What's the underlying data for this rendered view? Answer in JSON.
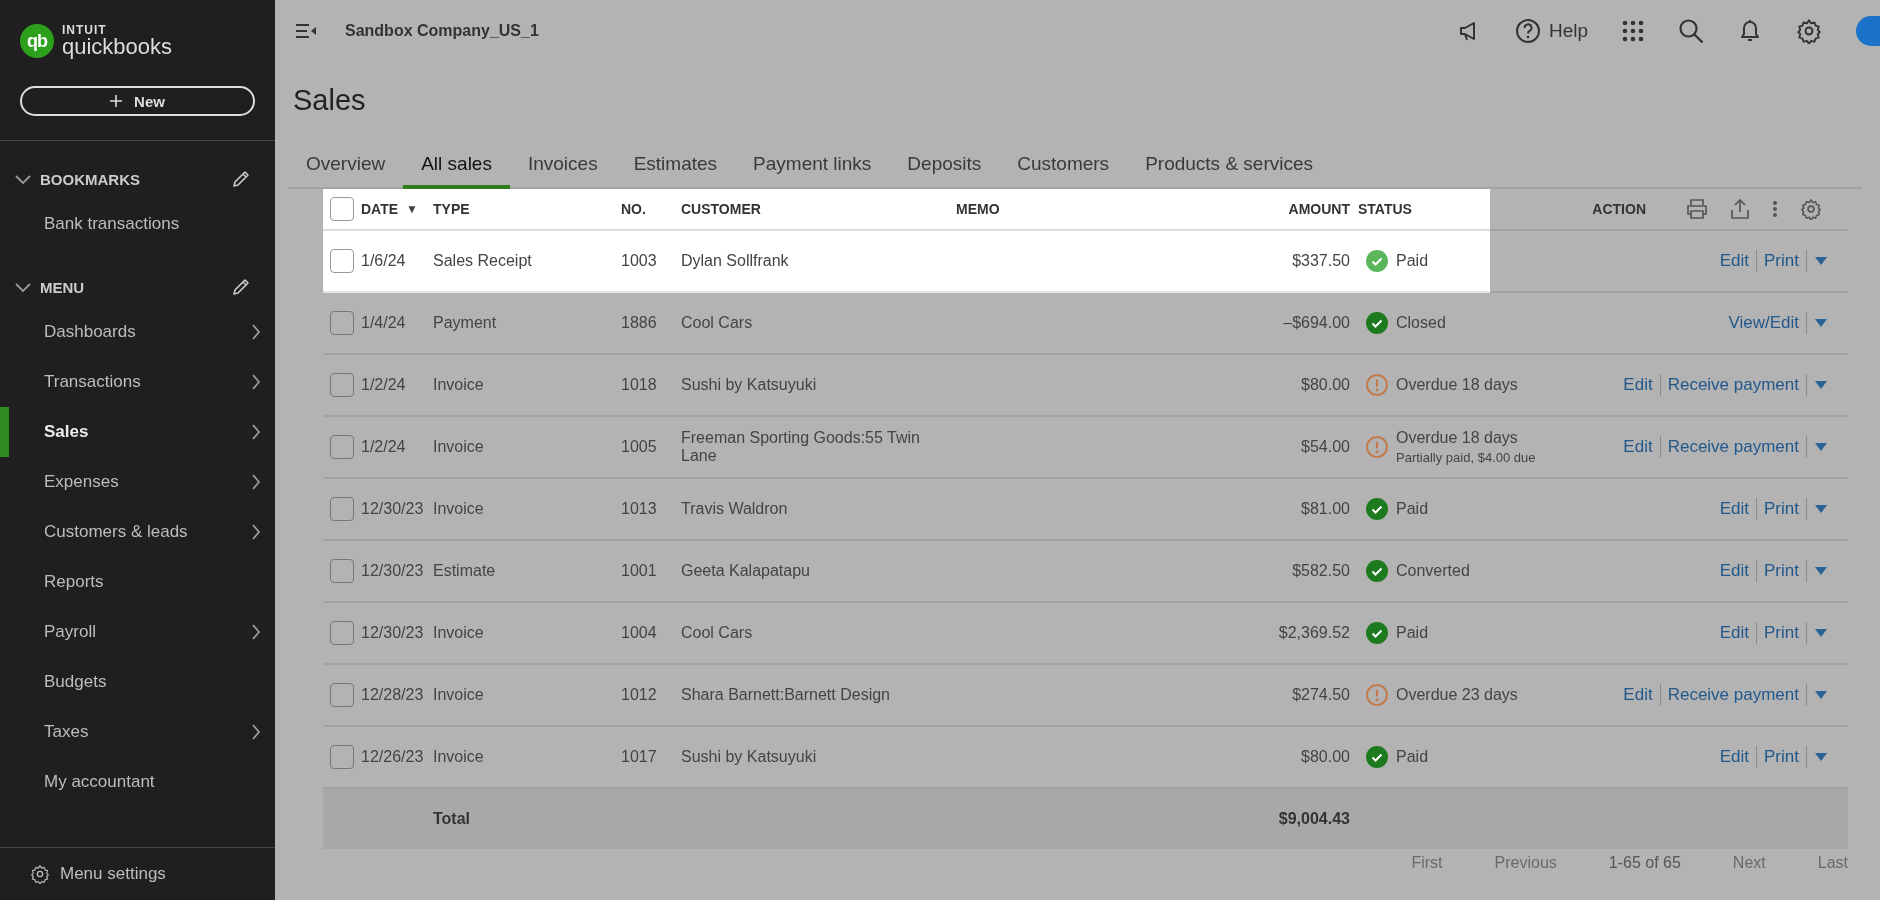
{
  "sidebar": {
    "logo": {
      "mark": "qb",
      "brand": "INTUIT",
      "product": "quickbooks"
    },
    "new_button": {
      "label": "New"
    },
    "sections": [
      {
        "title": "BOOKMARKS",
        "expanded": true,
        "items": [
          {
            "label": "Bank transactions",
            "selected": false,
            "has_children": false
          }
        ]
      },
      {
        "title": "MENU",
        "expanded": true,
        "items": [
          {
            "label": "Dashboards",
            "selected": false,
            "has_children": true
          },
          {
            "label": "Transactions",
            "selected": false,
            "has_children": true
          },
          {
            "label": "Sales",
            "selected": true,
            "has_children": true
          },
          {
            "label": "Expenses",
            "selected": false,
            "has_children": true
          },
          {
            "label": "Customers & leads",
            "selected": false,
            "has_children": true
          },
          {
            "label": "Reports",
            "selected": false,
            "has_children": false
          },
          {
            "label": "Payroll",
            "selected": false,
            "has_children": true
          },
          {
            "label": "Budgets",
            "selected": false,
            "has_children": false
          },
          {
            "label": "Taxes",
            "selected": false,
            "has_children": true
          },
          {
            "label": "My accountant",
            "selected": false,
            "has_children": false
          }
        ]
      }
    ],
    "footer": {
      "label": "Menu settings"
    }
  },
  "top_bar": {
    "company": "Sandbox Company_US_1",
    "help": "Help"
  },
  "page": {
    "title": "Sales"
  },
  "tabs": [
    {
      "label": "Overview",
      "selected": false
    },
    {
      "label": "All sales",
      "selected": true
    },
    {
      "label": "Invoices",
      "selected": false
    },
    {
      "label": "Estimates",
      "selected": false
    },
    {
      "label": "Payment links",
      "selected": false
    },
    {
      "label": "Deposits",
      "selected": false
    },
    {
      "label": "Customers",
      "selected": false
    },
    {
      "label": "Products & services",
      "selected": false
    }
  ],
  "table": {
    "header_highlighted": true,
    "select_all_checked": false,
    "columns": [
      {
        "label": "DATE",
        "sort": "▼"
      },
      {
        "label": "TYPE"
      },
      {
        "label": "NO."
      },
      {
        "label": "CUSTOMER"
      },
      {
        "label": "MEMO"
      },
      {
        "label": "AMOUNT"
      },
      {
        "label": "STATUS"
      },
      {
        "label": "ACTION"
      }
    ],
    "rows": [
      {
        "highlighted": true,
        "checked": false,
        "date": "1/6/24",
        "type": "Sales Receipt",
        "no": "1003",
        "customer": "Dylan Sollfrank",
        "amount": "$337.50",
        "status": {
          "kind": "check",
          "label": "Paid"
        },
        "actions": [
          "Edit",
          "Print"
        ]
      },
      {
        "highlighted": false,
        "checked": false,
        "date": "1/4/24",
        "type": "Payment",
        "no": "1886",
        "customer": "Cool Cars",
        "amount": "–$694.00",
        "status": {
          "kind": "check",
          "label": "Closed"
        },
        "actions": [
          "View/Edit"
        ]
      },
      {
        "highlighted": false,
        "checked": false,
        "date": "1/2/24",
        "type": "Invoice",
        "no": "1018",
        "customer": "Sushi by Katsuyuki",
        "amount": "$80.00",
        "status": {
          "kind": "warning",
          "label": "Overdue 18 days"
        },
        "actions": [
          "Edit",
          "Receive payment"
        ]
      },
      {
        "highlighted": false,
        "checked": false,
        "date": "1/2/24",
        "type": "Invoice",
        "no": "1005",
        "customer": "Freeman Sporting Goods:55 Twin Lane",
        "amount": "$54.00",
        "status": {
          "kind": "warning",
          "label": "Overdue 18 days",
          "note": "Partially paid, $4.00 due"
        },
        "actions": [
          "Edit",
          "Receive payment"
        ]
      },
      {
        "highlighted": false,
        "checked": false,
        "date": "12/30/23",
        "type": "Invoice",
        "no": "1013",
        "customer": "Travis Waldron",
        "amount": "$81.00",
        "status": {
          "kind": "check",
          "label": "Paid"
        },
        "actions": [
          "Edit",
          "Print"
        ]
      },
      {
        "highlighted": false,
        "checked": false,
        "date": "12/30/23",
        "type": "Estimate",
        "no": "1001",
        "customer": "Geeta Kalapatapu",
        "amount": "$582.50",
        "status": {
          "kind": "check",
          "label": "Converted"
        },
        "actions": [
          "Edit",
          "Print"
        ]
      },
      {
        "highlighted": false,
        "checked": false,
        "date": "12/30/23",
        "type": "Invoice",
        "no": "1004",
        "customer": "Cool Cars",
        "amount": "$2,369.52",
        "status": {
          "kind": "check",
          "label": "Paid"
        },
        "actions": [
          "Edit",
          "Print"
        ]
      },
      {
        "highlighted": false,
        "checked": false,
        "date": "12/28/23",
        "type": "Invoice",
        "no": "1012",
        "customer": "Shara Barnett:Barnett Design",
        "amount": "$274.50",
        "status": {
          "kind": "warning",
          "label": "Overdue 23 days"
        },
        "actions": [
          "Edit",
          "Receive payment"
        ]
      },
      {
        "highlighted": false,
        "checked": false,
        "date": "12/26/23",
        "type": "Invoice",
        "no": "1017",
        "customer": "Sushi by Katsuyuki",
        "amount": "$80.00",
        "status": {
          "kind": "check",
          "label": "Paid"
        },
        "actions": [
          "Edit",
          "Print"
        ]
      }
    ],
    "total": {
      "label": "Total",
      "amount": "$9,004.43"
    }
  },
  "pagination": {
    "first": {
      "label": "First",
      "disabled": true
    },
    "previous": {
      "label": "Previous",
      "disabled": true
    },
    "range": "1-65 of 65",
    "next": {
      "label": "Next",
      "disabled": true
    },
    "last": {
      "label": "Last",
      "disabled": true
    }
  }
}
